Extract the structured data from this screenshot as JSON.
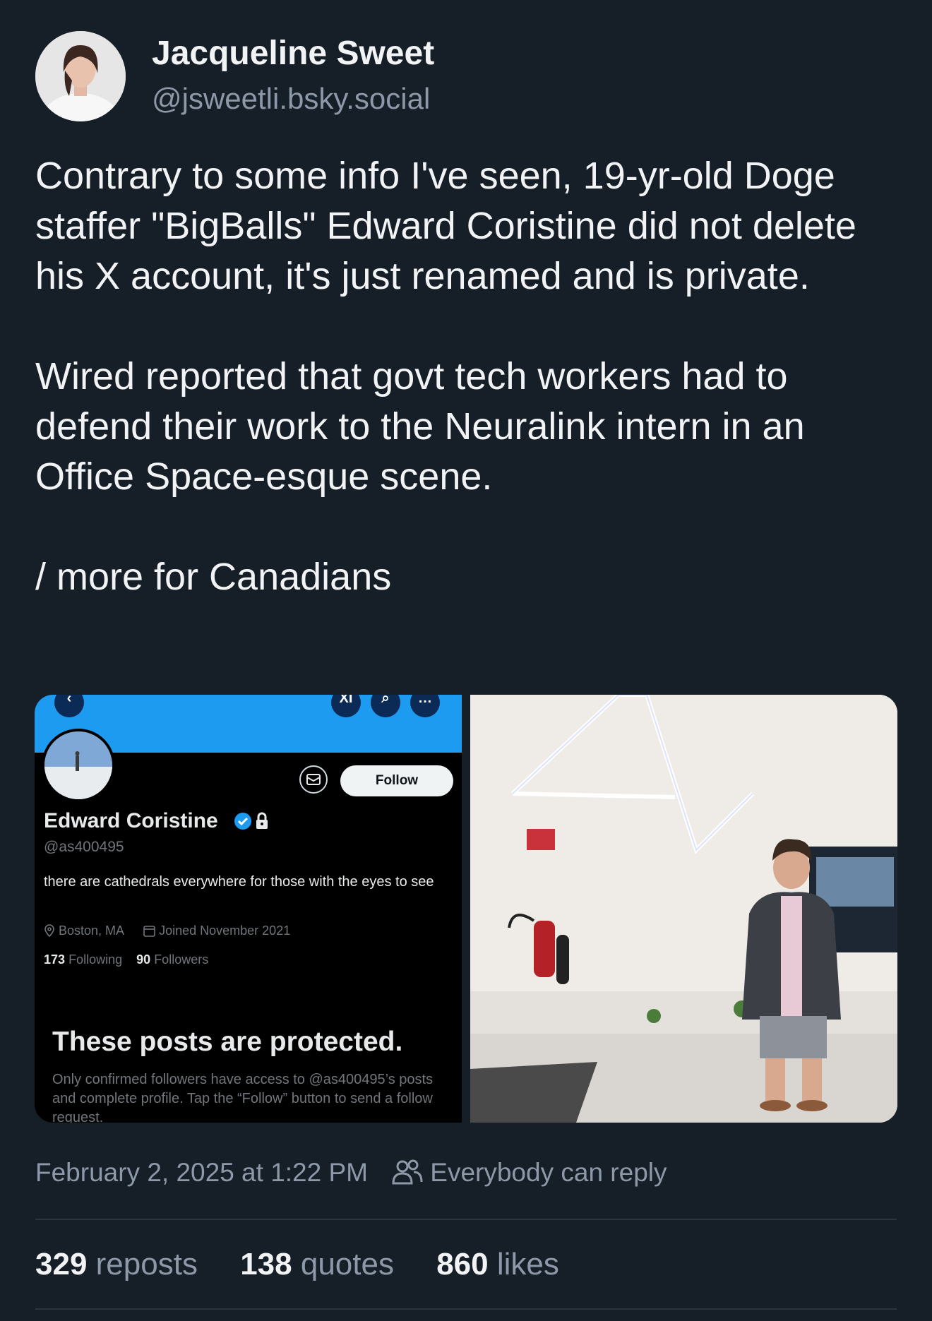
{
  "author": {
    "name": "Jacqueline Sweet",
    "handle": "@jsweetli.bsky.social"
  },
  "post": {
    "paragraphs": [
      "Contrary to some info I've seen, 19-yr-old Doge staffer \"BigBalls\" Edward Coristine did not delete his X account, it's just renamed and is private.",
      "Wired reported that govt tech workers had to defend their work to the Neuralink intern in an Office Space-esque scene.",
      "/ more for Canadians"
    ],
    "timestamp": "February 2, 2025 at 1:22 PM",
    "reply_setting": "Everybody can reply",
    "stats": {
      "reposts_count": "329",
      "reposts_label": "reposts",
      "quotes_count": "138",
      "quotes_label": "quotes",
      "likes_count": "860",
      "likes_label": "likes"
    }
  },
  "embedded_profile": {
    "top_icon_label": "XI",
    "follow_label": "Follow",
    "name": "Edward Coristine",
    "handle": "@as400495",
    "bio": "there are cathedrals everywhere for those with the eyes to see",
    "location": "Boston, MA",
    "joined": "Joined November 2021",
    "following_count": "173",
    "following_label": "Following",
    "followers_count": "90",
    "followers_label": "Followers",
    "protected_title": "These posts are protected.",
    "protected_body": "Only confirmed followers have access to @as400495’s posts and complete profile. Tap the “Follow” button to send a follow request."
  },
  "colors": {
    "background": "#161e27",
    "text": "#f1f3f5",
    "muted": "#8d99a8",
    "x_blue": "#1d9bf0"
  }
}
